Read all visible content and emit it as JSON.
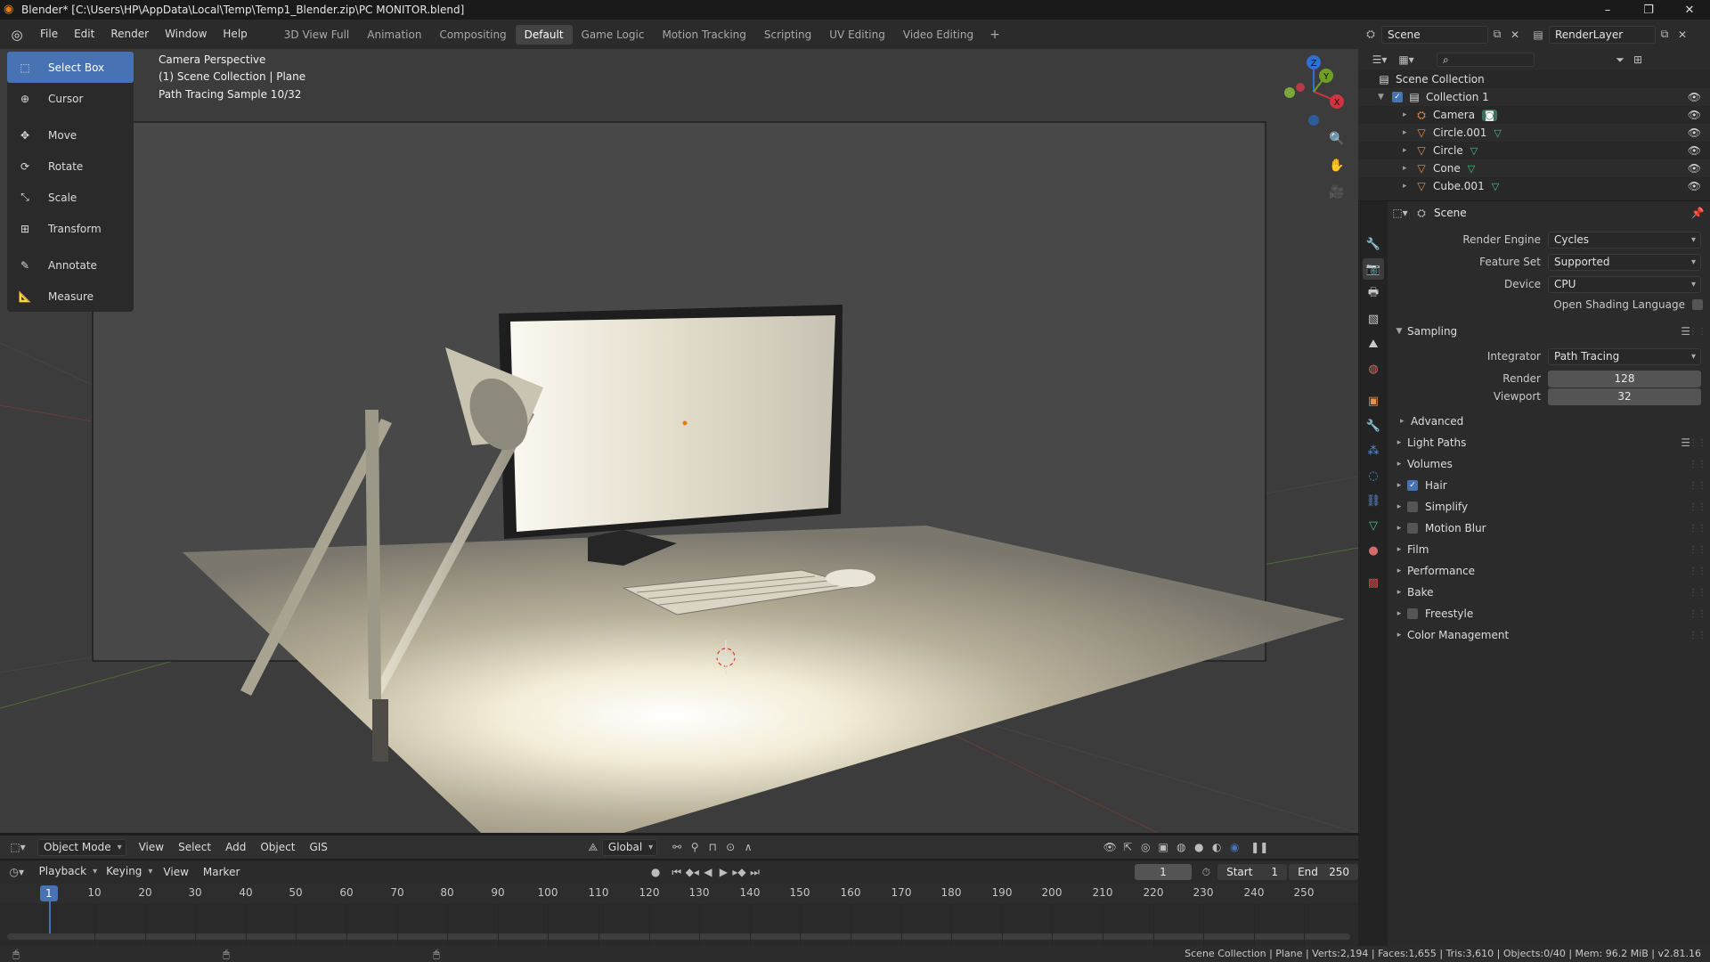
{
  "window": {
    "title": "Blender* [C:\\Users\\HP\\AppData\\Local\\Temp\\Temp1_Blender.zip\\PC MONITOR.blend]",
    "buttons": [
      "–",
      "❐",
      "✕"
    ]
  },
  "menu": [
    "File",
    "Edit",
    "Render",
    "Window",
    "Help"
  ],
  "workspaces": [
    "3D View Full",
    "Animation",
    "Compositing",
    "Default",
    "Game Logic",
    "Motion Tracking",
    "Scripting",
    "UV Editing",
    "Video Editing"
  ],
  "active_workspace": "Default",
  "scene_name": "Scene",
  "view_layer": "RenderLayer",
  "viewport": {
    "overlay_lines": [
      "Camera Perspective",
      "(1) Scene Collection | Plane",
      "Path Tracing Sample 10/32"
    ]
  },
  "tools": [
    {
      "label": "Select Box",
      "icon": "select-box-icon",
      "active": true
    },
    {
      "label": "Cursor",
      "icon": "cursor-icon"
    },
    {
      "label": "Move",
      "icon": "move-icon"
    },
    {
      "label": "Rotate",
      "icon": "rotate-icon"
    },
    {
      "label": "Scale",
      "icon": "scale-icon"
    },
    {
      "label": "Transform",
      "icon": "transform-icon"
    },
    {
      "label": "Annotate",
      "icon": "annotate-icon"
    },
    {
      "label": "Measure",
      "icon": "measure-icon"
    }
  ],
  "gizmo": {
    "x": "X",
    "y": "Y",
    "z": "Z"
  },
  "vp_header": {
    "mode": "Object Mode",
    "menus": [
      "View",
      "Select",
      "Add",
      "Object",
      "GIS"
    ],
    "orientation": "Global"
  },
  "timeline": {
    "menus": [
      "Playback",
      "Keying",
      "View",
      "Marker"
    ],
    "current_frame": "1",
    "start_label": "Start",
    "start": "1",
    "end_label": "End",
    "end": "250",
    "ruler": [
      "10",
      "20",
      "30",
      "40",
      "50",
      "60",
      "70",
      "80",
      "90",
      "100",
      "110",
      "120",
      "130",
      "140",
      "150",
      "160",
      "170",
      "180",
      "190",
      "200",
      "210",
      "220",
      "230",
      "240",
      "250"
    ],
    "marker_label": "1"
  },
  "status": "Scene Collection | Plane | Verts:2,194 | Faces:1,655 | Tris:3,610 | Objects:0/40 | Mem: 96.2 MiB | v2.81.16",
  "outliner": {
    "root": "Scene Collection",
    "collection": "Collection 1",
    "objects": [
      "Camera",
      "Circle.001",
      "Circle",
      "Cone",
      "Cube.001"
    ]
  },
  "properties": {
    "header": "Scene",
    "render_engine_label": "Render Engine",
    "render_engine": "Cycles",
    "feature_set_label": "Feature Set",
    "feature_set": "Supported",
    "device_label": "Device",
    "device": "CPU",
    "osl_label": "Open Shading Language",
    "sampling": "Sampling",
    "integrator_label": "Integrator",
    "integrator": "Path Tracing",
    "render_label": "Render",
    "render_samples": "128",
    "viewport_label": "Viewport",
    "viewport_samples": "32",
    "advanced": "Advanced",
    "panels": [
      {
        "label": "Light Paths",
        "checkbox": false,
        "menu": true
      },
      {
        "label": "Volumes",
        "checkbox": false
      },
      {
        "label": "Hair",
        "checkbox": true,
        "checked": true
      },
      {
        "label": "Simplify",
        "checkbox": true,
        "checked": false
      },
      {
        "label": "Motion Blur",
        "checkbox": true,
        "checked": false
      },
      {
        "label": "Film",
        "checkbox": false
      },
      {
        "label": "Performance",
        "checkbox": false
      },
      {
        "label": "Bake",
        "checkbox": false
      },
      {
        "label": "Freestyle",
        "checkbox": true,
        "checked": false
      },
      {
        "label": "Color Management",
        "checkbox": false
      }
    ]
  },
  "colors": {
    "accent": "#4772b3",
    "viewport_bg": "#3c3c3c",
    "panel_bg": "#2b2b2b"
  }
}
